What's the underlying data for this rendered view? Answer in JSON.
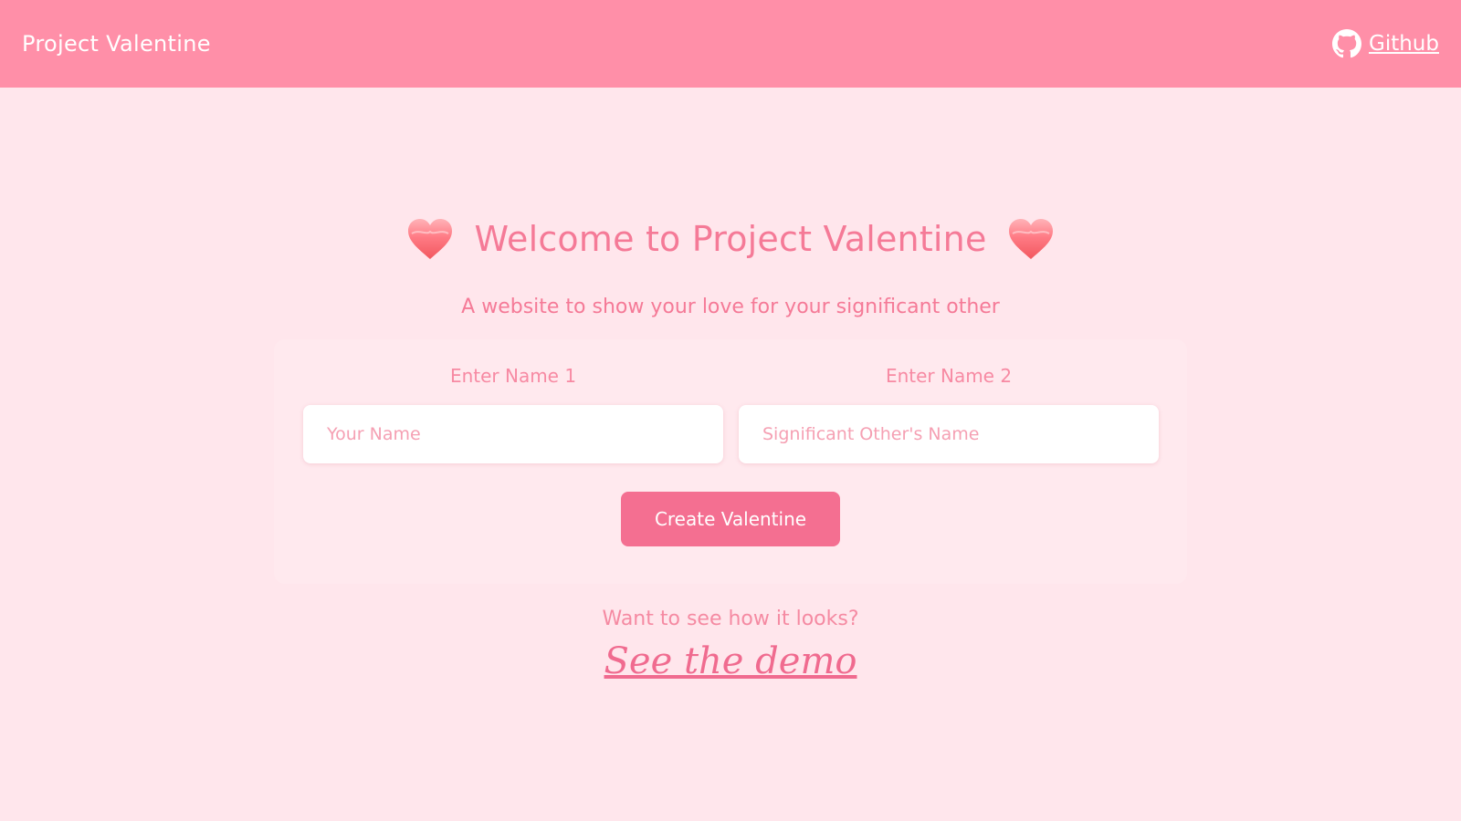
{
  "navbar": {
    "brand": "Project Valentine",
    "github_label": "Github",
    "github_icon": "github-icon"
  },
  "hero": {
    "title": "Welcome to Project Valentine",
    "subtitle": "A website to show your love for your significant other",
    "icons": [
      "heart-icon",
      "heart-icon"
    ]
  },
  "form": {
    "name1_label": "Enter Name 1",
    "name1_placeholder": "Your Name",
    "name1_value": "",
    "name2_label": "Enter Name 2",
    "name2_placeholder": "Significant Other's Name",
    "name2_value": "",
    "submit_label": "Create Valentine"
  },
  "demo": {
    "question": "Want to see how it looks?",
    "link_label": "See the demo"
  },
  "colors": {
    "navbar_bg": "#ff8fa8",
    "page_bg": "#ffe6ec",
    "accent": "#f46f91",
    "text_pink": "#f57a97"
  }
}
